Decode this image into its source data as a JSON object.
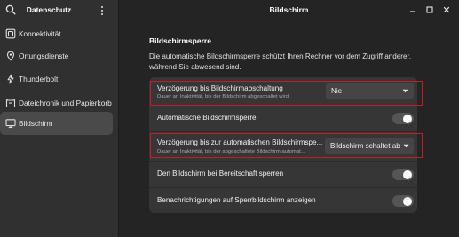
{
  "sidebar": {
    "title": "Datenschutz",
    "search_icon": "search-icon",
    "menu_icon": "kebab-menu-icon",
    "items": [
      {
        "label": "Konnektivität",
        "icon": "connectivity-icon",
        "active": false
      },
      {
        "label": "Ortungsdienste",
        "icon": "location-icon",
        "active": false
      },
      {
        "label": "Thunderbolt",
        "icon": "thunderbolt-icon",
        "active": false
      },
      {
        "label": "Dateichronik und Papierkorb",
        "icon": "file-history-icon",
        "active": false
      },
      {
        "label": "Bildschirm",
        "icon": "display-icon",
        "active": true
      }
    ]
  },
  "header": {
    "title": "Bildschirm",
    "window_buttons": [
      "minimize-icon",
      "maximize-icon",
      "close-icon"
    ]
  },
  "main": {
    "section_title": "Bildschirmsperre",
    "section_description": "Die automatische Bildschirmsperre schützt Ihren Rechner vor dem Zugriff anderer, während Sie abwesend sind.",
    "rows": [
      {
        "title": "Verzögerung bis Bildschirmabschaltung",
        "subtitle": "Dauer an Inaktivität, bis der Bildschirm abgeschaltet wird.",
        "control": "dropdown",
        "value": "Nie",
        "highlighted": true
      },
      {
        "title": "Automatische Bildschirmsperre",
        "control": "switch",
        "state": "on"
      },
      {
        "title": "Verzögerung bis zur automatischen Bildschirmspe...",
        "subtitle": "Dauer an Inaktivität, bis der abgeschaltete Bildschirm automat...",
        "control": "dropdown",
        "value": "Bildschirm schaltet ab",
        "highlighted": true
      },
      {
        "title": "Den Bildschirm bei Bereitschaft sperren",
        "control": "switch",
        "state": "on"
      },
      {
        "title": "Benachrichtigungen auf Sperrbildschirm anzeigen",
        "control": "switch",
        "state": "on"
      }
    ]
  },
  "colors": {
    "window_bg": "#242424",
    "sidebar_bg": "#303030",
    "card_bg": "#363636",
    "highlight_border": "#c41e24"
  }
}
